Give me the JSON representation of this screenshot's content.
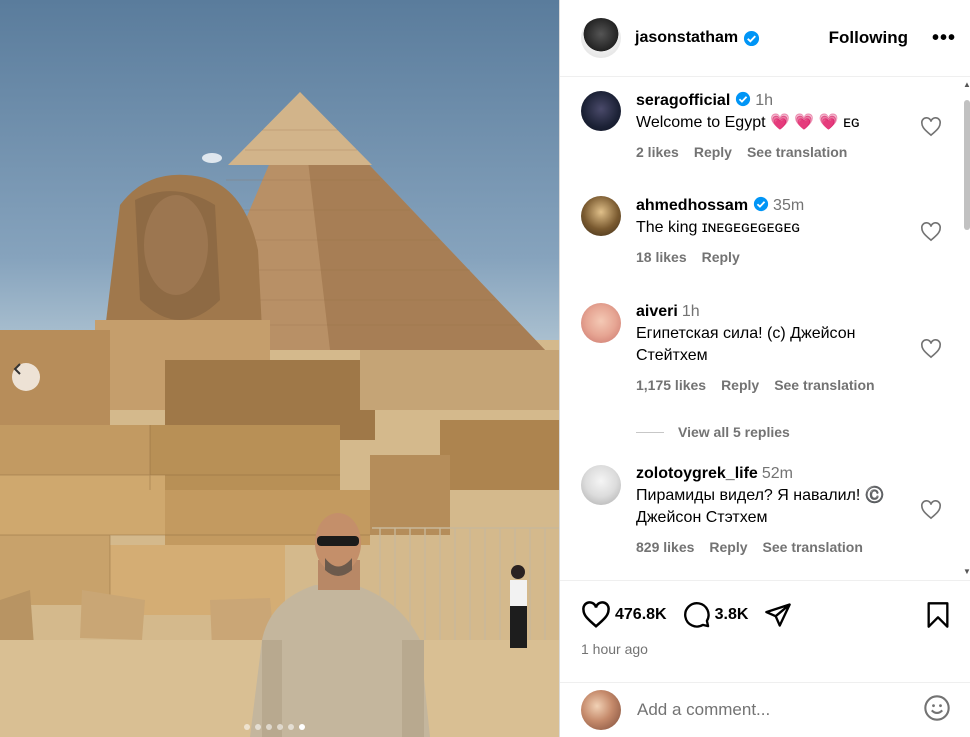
{
  "post": {
    "author": "jasonstatham",
    "follow_label": "Following",
    "more_label": "•••",
    "likes_count": "476.8K",
    "comments_count": "3.8K",
    "time_ago": "1 hour ago",
    "add_comment_placeholder": "Add a comment...",
    "carousel_dots": 6,
    "active_dot": 6
  },
  "comments": [
    {
      "user": "seragofficial",
      "verified": true,
      "time": "1h",
      "text": "Welcome to Egypt 💗 💗 💗 ᴇɢ",
      "likes": "2 likes",
      "reply": "Reply",
      "translate": "See translation"
    },
    {
      "user": "ahmedhossam",
      "verified": true,
      "time": "35m",
      "text": "The king ɪɴᴇɢᴇɢᴇɢᴇɢᴇɢ",
      "likes": "18 likes",
      "reply": "Reply",
      "translate": ""
    },
    {
      "user": "aiveri",
      "verified": false,
      "time": "1h",
      "text": "Египетская сила! (c) Джейсон Стейтхем",
      "likes": "1,175 likes",
      "reply": "Reply",
      "translate": "See translation"
    },
    {
      "user": "zolotoygrek_life",
      "verified": false,
      "time": "52m",
      "text": "Пирамиды видел? Я навалил! ©️ Джейсон Стэтхем",
      "likes": "829 likes",
      "reply": "Reply",
      "translate": "See translation"
    }
  ],
  "view_replies_label": "View all 5 replies",
  "colors": {
    "verified_blue": "#0095f6",
    "muted_text": "#737373",
    "divider": "#efefef"
  }
}
